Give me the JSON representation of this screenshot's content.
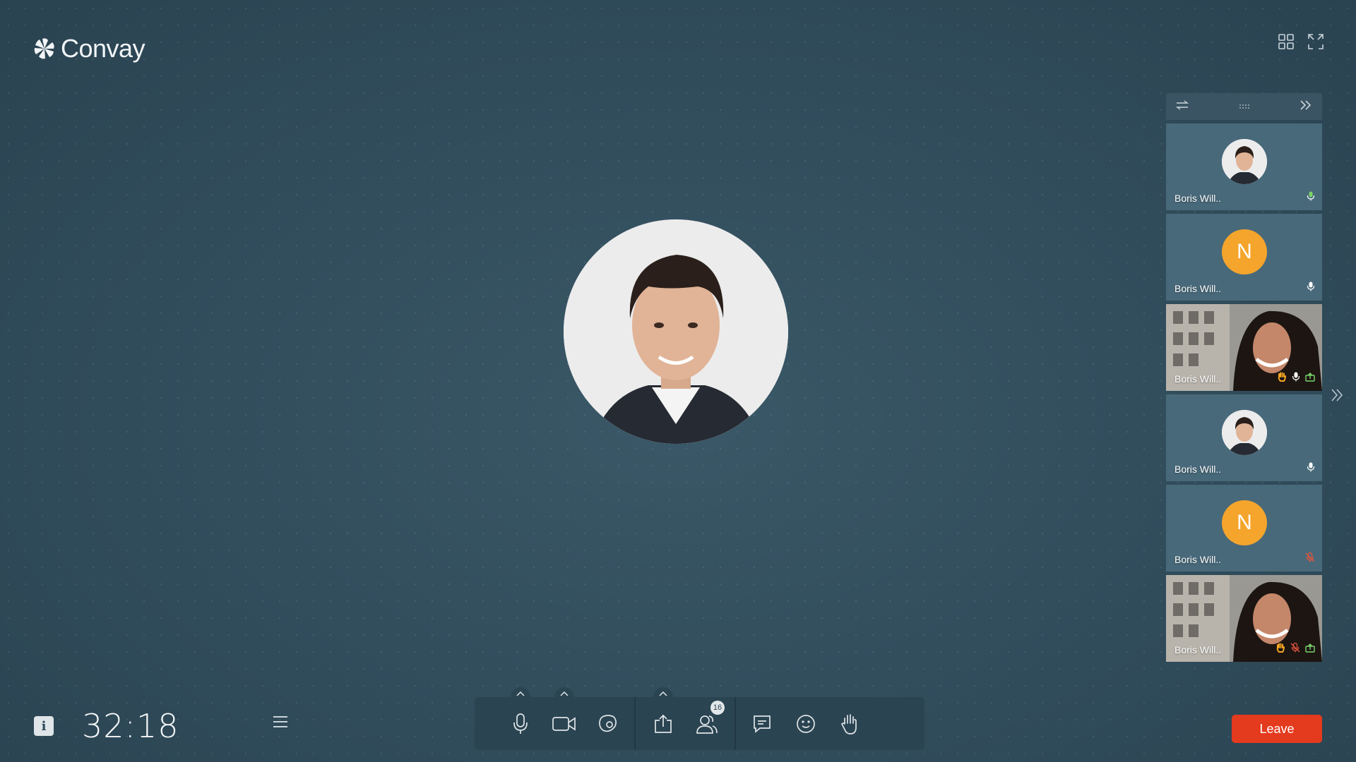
{
  "app": {
    "name": "Convay"
  },
  "colors": {
    "leave": "#e43a1e",
    "avatar_letter_bg": "#f5a52c",
    "mic_active": "#7bd36a",
    "muted": "#e5543c",
    "hand": "#f5a623"
  },
  "top_icons": [
    "grid-view-icon",
    "fullscreen-icon"
  ],
  "participants": [
    {
      "name": "Boris Will..",
      "avatar": "photo",
      "status": [
        "mic-active"
      ]
    },
    {
      "name": "Boris Will..",
      "avatar": "letter",
      "letter": "N",
      "status": [
        "mic"
      ]
    },
    {
      "name": "Boris Will..",
      "avatar": "video",
      "status": [
        "hand",
        "mic",
        "share"
      ]
    },
    {
      "name": "Boris Will..",
      "avatar": "photo",
      "status": [
        "mic"
      ]
    },
    {
      "name": "Boris Will..",
      "avatar": "letter",
      "letter": "N",
      "status": [
        "mic-muted"
      ]
    },
    {
      "name": "Boris Will..",
      "avatar": "video",
      "status": [
        "hand",
        "mic-muted",
        "share"
      ]
    }
  ],
  "footer": {
    "info_label": "i",
    "timer": "32:18",
    "participants_count": "16",
    "leave_label": "Leave"
  }
}
